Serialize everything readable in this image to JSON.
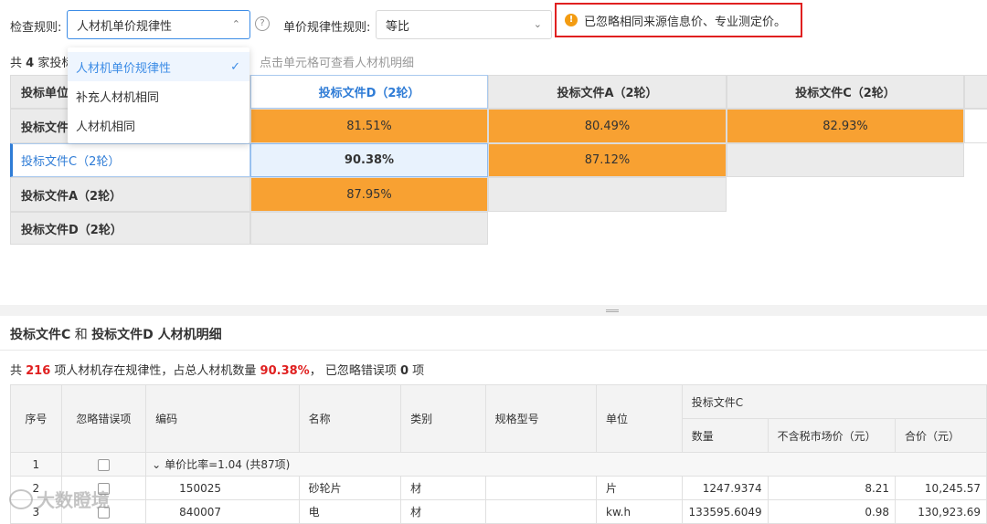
{
  "filters": {
    "check_rule_label": "检查规则:",
    "check_rule_value": "人材机单价规律性",
    "unit_price_rule_label": "单价规律性规则:",
    "unit_price_rule_value": "等比",
    "help_icon": "?"
  },
  "alert": {
    "text": "已忽略相同来源信息价、专业测定价。",
    "color": "#e02020"
  },
  "dropdown": {
    "options": [
      "人材机单价规律性",
      "补充人材机相同",
      "人材机相同"
    ],
    "selected_index": 0
  },
  "summary": {
    "prefix": "共",
    "count": "4",
    "suffix": "家投标"
  },
  "hint": "点击单元格可查看人材机明细",
  "matrix": {
    "corner": "投标单位",
    "columns": [
      "投标文件D（2轮）",
      "投标文件A（2轮）",
      "投标文件C（2轮）"
    ],
    "rows": [
      {
        "label": "投标文件",
        "cells": [
          "81.51%",
          "80.49%",
          "82.93%"
        ]
      },
      {
        "label": "投标文件C（2轮）",
        "cells": [
          "90.38%",
          "87.12%",
          ""
        ]
      },
      {
        "label": "投标文件A（2轮）",
        "cells": [
          "87.95%",
          "",
          ""
        ]
      },
      {
        "label": "投标文件D（2轮）",
        "cells": [
          "",
          "",
          ""
        ]
      }
    ],
    "highlight_color": "#f8a132"
  },
  "detail": {
    "title_a": "投标文件C",
    "title_and": " 和 ",
    "title_b": "投标文件D",
    "title_suffix": " 人材机明细",
    "stats": {
      "p1": "共 ",
      "count": "216",
      "p2": " 项人材机存在规律性，占总人材机数量 ",
      "percent": "90.38%",
      "p3": "， 已忽略错误项 ",
      "ignored": "0",
      "p4": " 项"
    }
  },
  "table": {
    "headers": {
      "seq": "序号",
      "ignore": "忽略错误项",
      "code": "编码",
      "name": "名称",
      "category": "类别",
      "spec": "规格型号",
      "unit": "单位",
      "group": "投标文件C",
      "qty": "数量",
      "price": "不含税市场价（元）",
      "total": "合价（元）"
    },
    "group_row": {
      "seq": "1",
      "label": "单价比率=1.04 (共87项)",
      "chevron": "⌄"
    },
    "rows": [
      {
        "seq": "2",
        "code": "150025",
        "name": "砂轮片",
        "category": "材",
        "spec": "",
        "unit": "片",
        "qty": "1247.9374",
        "price": "8.21",
        "total": "10,245.57"
      },
      {
        "seq": "3",
        "code": "840007",
        "name": "电",
        "category": "材",
        "spec": "",
        "unit": "kw.h",
        "qty": "133595.6049",
        "price": "0.98",
        "total": "130,923.69"
      }
    ]
  },
  "watermark": "大数瞪境"
}
